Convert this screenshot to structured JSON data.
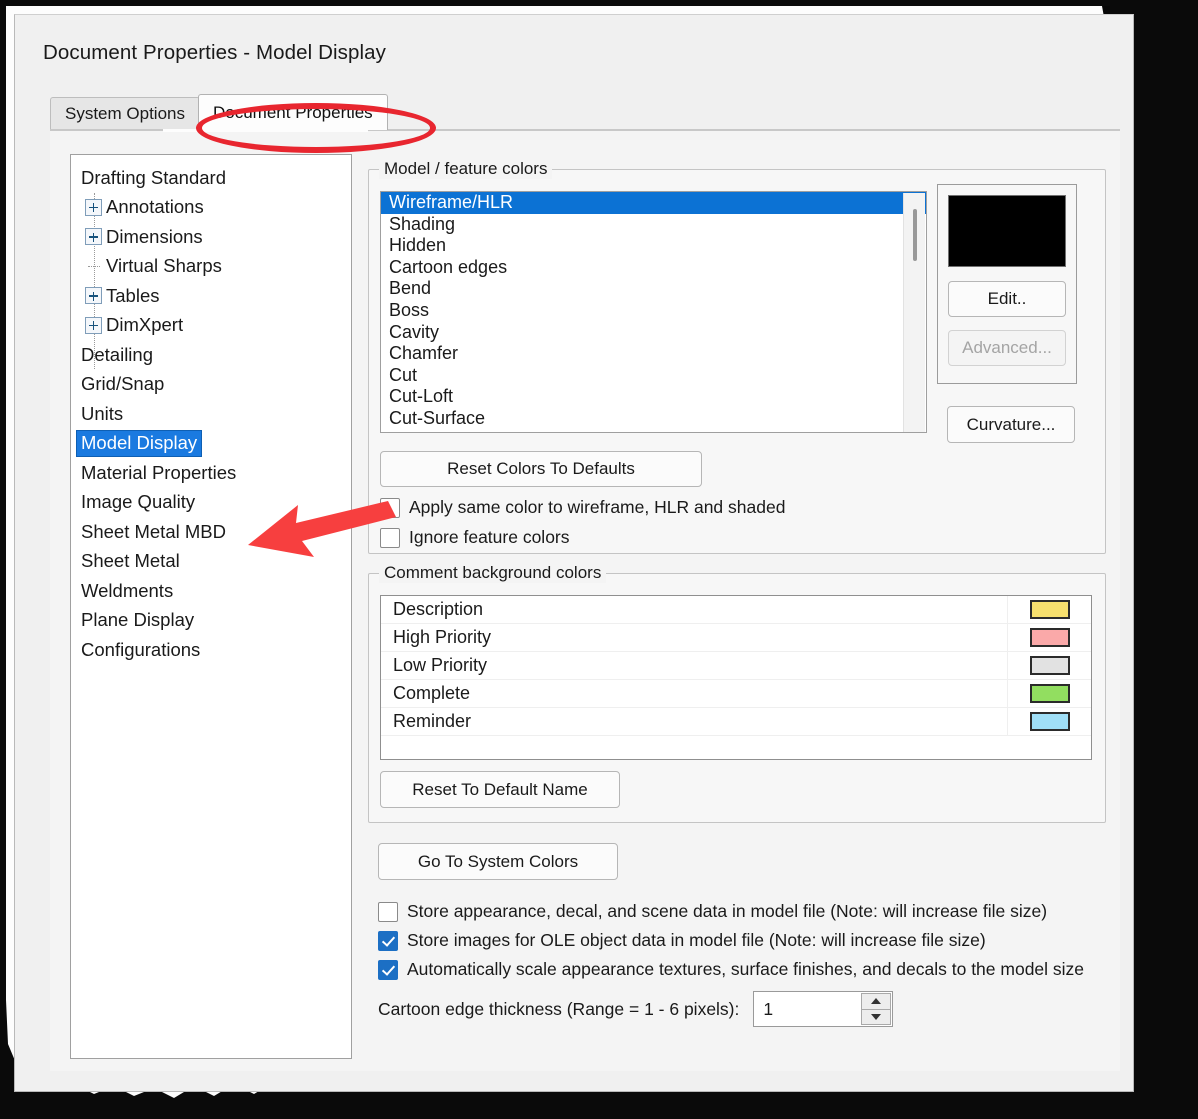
{
  "window": {
    "title": "Document Properties - Model Display"
  },
  "tabs": [
    {
      "label": "System Options",
      "active": false
    },
    {
      "label": "Document Properties",
      "active": true
    }
  ],
  "sidebar": {
    "items": [
      {
        "label": "Drafting Standard",
        "level": 0,
        "icon": "none",
        "selected": false
      },
      {
        "label": "Annotations",
        "level": 1,
        "icon": "expander",
        "selected": false
      },
      {
        "label": "Dimensions",
        "level": 1,
        "icon": "expander",
        "selected": false
      },
      {
        "label": "Virtual Sharps",
        "level": 1,
        "icon": "leaf",
        "selected": false
      },
      {
        "label": "Tables",
        "level": 1,
        "icon": "expander",
        "selected": false
      },
      {
        "label": "DimXpert",
        "level": 1,
        "icon": "expander",
        "selected": false
      },
      {
        "label": "Detailing",
        "level": 0,
        "icon": "none",
        "selected": false
      },
      {
        "label": "Grid/Snap",
        "level": 0,
        "icon": "none",
        "selected": false
      },
      {
        "label": "Units",
        "level": 0,
        "icon": "none",
        "selected": false
      },
      {
        "label": "Model Display",
        "level": 0,
        "icon": "none",
        "selected": true
      },
      {
        "label": "Material Properties",
        "level": 0,
        "icon": "none",
        "selected": false
      },
      {
        "label": "Image Quality",
        "level": 0,
        "icon": "none",
        "selected": false
      },
      {
        "label": "Sheet Metal MBD",
        "level": 0,
        "icon": "none",
        "selected": false
      },
      {
        "label": "Sheet Metal",
        "level": 0,
        "icon": "none",
        "selected": false
      },
      {
        "label": "Weldments",
        "level": 0,
        "icon": "none",
        "selected": false
      },
      {
        "label": "Plane Display",
        "level": 0,
        "icon": "none",
        "selected": false
      },
      {
        "label": "Configurations",
        "level": 0,
        "icon": "none",
        "selected": false
      }
    ]
  },
  "model_colors": {
    "legend": "Model / feature colors",
    "items": [
      {
        "label": "Wireframe/HLR",
        "selected": true
      },
      {
        "label": "Shading",
        "selected": false
      },
      {
        "label": "Hidden",
        "selected": false
      },
      {
        "label": "Cartoon edges",
        "selected": false
      },
      {
        "label": "Bend",
        "selected": false
      },
      {
        "label": "Boss",
        "selected": false
      },
      {
        "label": "Cavity",
        "selected": false
      },
      {
        "label": "Chamfer",
        "selected": false
      },
      {
        "label": "Cut",
        "selected": false
      },
      {
        "label": "Cut-Loft",
        "selected": false
      },
      {
        "label": "Cut-Surface",
        "selected": false
      }
    ],
    "preview_color": "#000000",
    "edit_label": "Edit..",
    "advanced_label": "Advanced...",
    "curvature_label": "Curvature...",
    "reset_colors_label": "Reset Colors To Defaults",
    "apply_same_color_label": "Apply same color to wireframe, HLR and shaded",
    "apply_same_color_checked": false,
    "ignore_feature_colors_label": "Ignore feature colors",
    "ignore_feature_colors_checked": false
  },
  "comment_colors": {
    "legend": "Comment background colors",
    "rows": [
      {
        "name": "Description",
        "color": "#f7e06e"
      },
      {
        "name": "High Priority",
        "color": "#faa9a9"
      },
      {
        "name": "Low Priority",
        "color": "#e2e2e2"
      },
      {
        "name": "Complete",
        "color": "#92de60"
      },
      {
        "name": "Reminder",
        "color": "#a0dff7"
      }
    ],
    "reset_default_name_label": "Reset To Default Name"
  },
  "bottom": {
    "go_to_system_colors_label": "Go To System Colors",
    "options": [
      {
        "label": "Store appearance, decal, and scene data in model file (Note: will increase file size)",
        "checked": false
      },
      {
        "label": "Store images for OLE object data in model file (Note: will increase file size)",
        "checked": true
      },
      {
        "label": "Automatically scale appearance textures, surface finishes, and decals to the model size",
        "checked": true
      }
    ],
    "cartoon_edge_label": "Cartoon edge thickness (Range = 1 - 6 pixels):",
    "cartoon_edge_value": "1"
  },
  "annotations": {
    "ellipse_color": "#e8262f",
    "arrow_color": "#f73f3f",
    "arrow_target": "Model Display",
    "ellipse_target": "Document Properties"
  }
}
